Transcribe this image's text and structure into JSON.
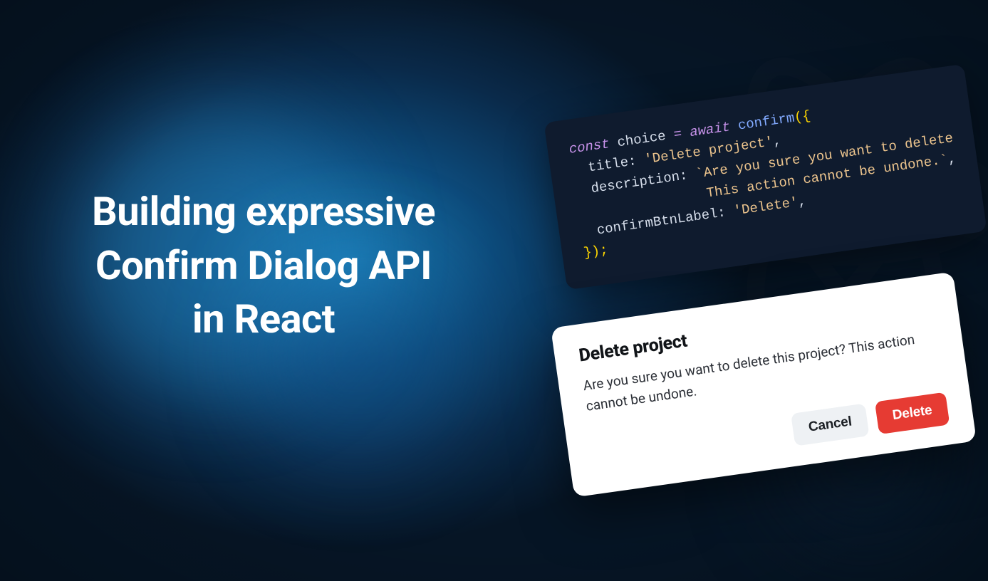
{
  "headline": {
    "line1": "Building expressive",
    "line2": "Confirm Dialog API",
    "line3": "in React"
  },
  "code": {
    "kw_const": "const",
    "var_choice": "choice",
    "eq": "=",
    "kw_await": "await",
    "fn_confirm": "confirm",
    "open": "({",
    "prop_title": "title",
    "colon": ":",
    "val_title": "'Delete project'",
    "comma": ",",
    "prop_desc": "description",
    "val_desc_l1": "`Are you sure you want to delete",
    "val_desc_l2": "This action cannot be undone.`",
    "prop_confirm": "confirmBtnLabel",
    "val_confirm": "'Delete'",
    "close": "});"
  },
  "dialog": {
    "title": "Delete project",
    "description": "Are you sure you want to delete this project? This action cannot be undone.",
    "cancel_label": "Cancel",
    "delete_label": "Delete"
  }
}
